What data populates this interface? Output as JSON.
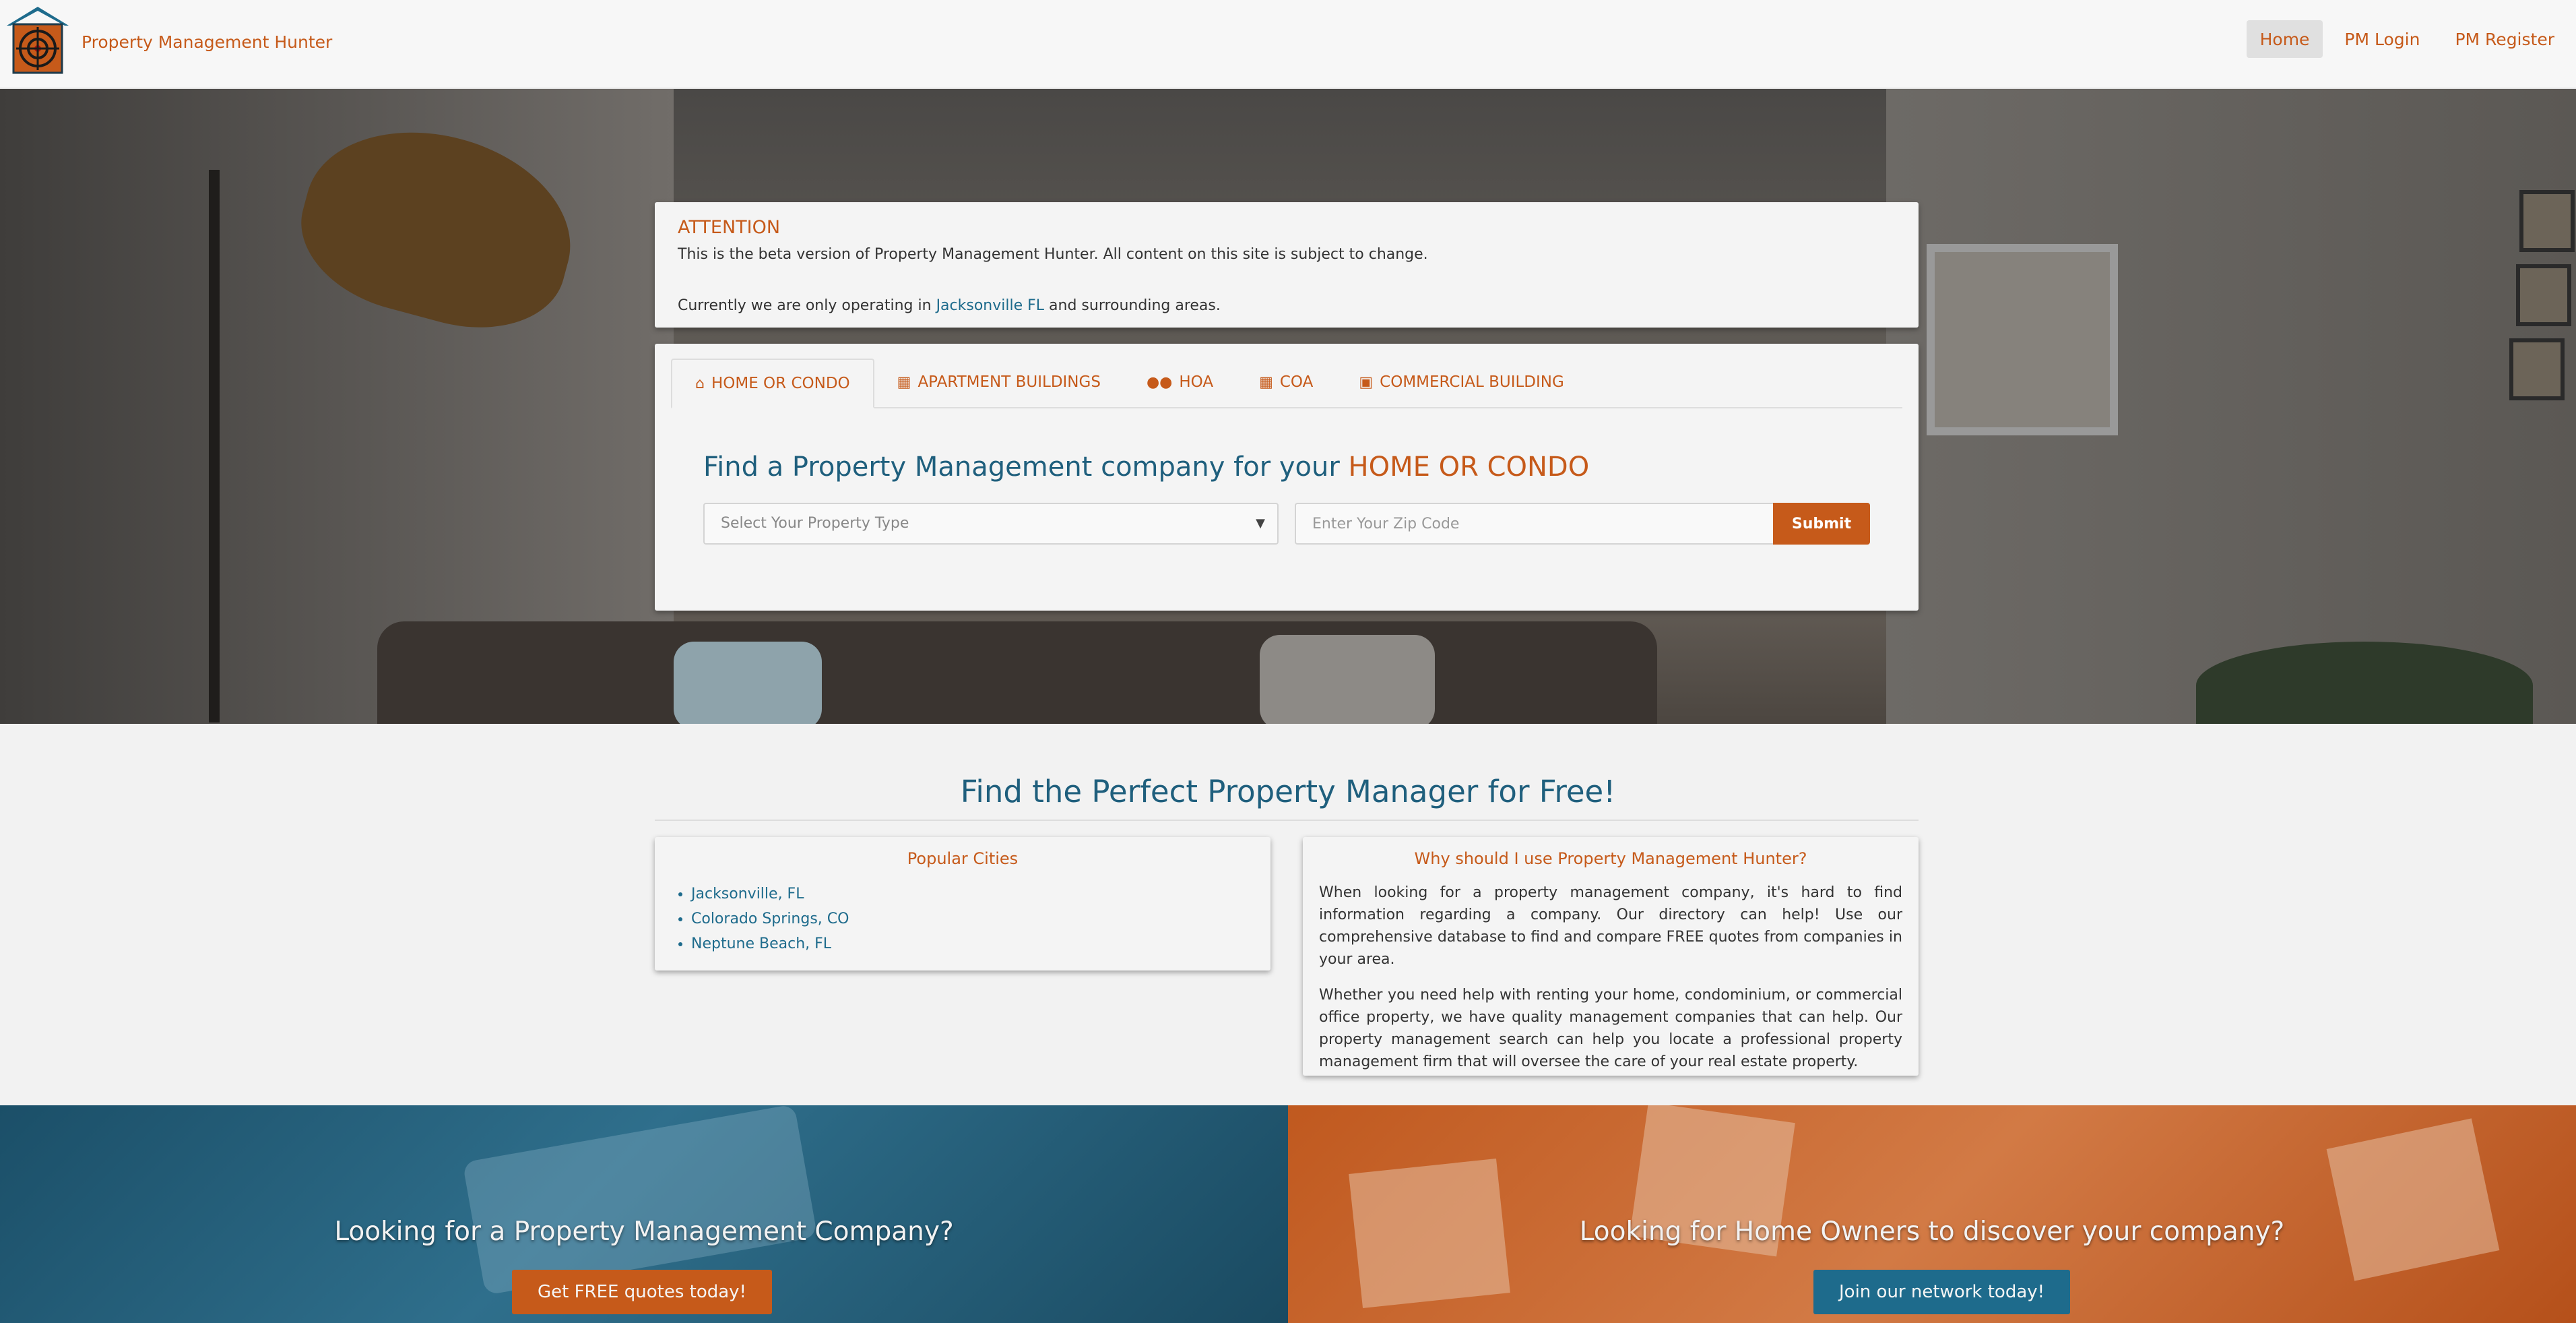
{
  "navbar": {
    "brand": "Property Management Hunter",
    "links": [
      {
        "label": "Home",
        "active": true
      },
      {
        "label": "PM Login",
        "active": false
      },
      {
        "label": "PM Register",
        "active": false
      }
    ]
  },
  "attention": {
    "title": "ATTENTION",
    "line1": "This is the beta version of Property Management Hunter. All content on this site is subject to change.",
    "line2_prefix": "Currently we are only operating in ",
    "line2_link": "Jacksonville FL",
    "line2_suffix": " and surrounding areas."
  },
  "search": {
    "tabs": [
      {
        "label": "HOME OR CONDO",
        "icon": "home-icon",
        "active": true
      },
      {
        "label": "APARTMENT BUILDINGS",
        "icon": "building-icon",
        "active": false
      },
      {
        "label": "HOA",
        "icon": "users-icon",
        "active": false
      },
      {
        "label": "COA",
        "icon": "building-icon",
        "active": false
      },
      {
        "label": "COMMERCIAL BUILDING",
        "icon": "briefcase-icon",
        "active": false
      }
    ],
    "heading_prefix": "Find a Property Management company for your ",
    "heading_highlight": "HOME OR CONDO",
    "select_placeholder": "Select Your Property Type",
    "zip_placeholder": "Enter Your Zip Code",
    "submit_label": "Submit"
  },
  "free": {
    "title": "Find the Perfect Property Manager for Free!",
    "cities_title": "Popular Cities",
    "cities": [
      "Jacksonville, FL",
      "Colorado Springs, CO",
      "Neptune Beach, FL"
    ],
    "why_title": "Why should I use Property Management Hunter?",
    "why_p1": "When looking for a property management company, it's hard to find information regarding a company. Our directory can help! Use our comprehensive database to find and compare FREE quotes from companies in your area.",
    "why_p2": "Whether you need help with renting your home, condominium, or commercial office property, we have quality management companies that can help. Our property management search can help you locate a professional property management firm that will oversee the care of your real estate property."
  },
  "banners": {
    "left_text": "Looking for a Property Management Company?",
    "left_button": "Get FREE quotes today!",
    "right_text": "Looking for Home Owners to discover your company?",
    "right_button": "Join our network today!"
  },
  "colors": {
    "brand_orange": "#c65a1a",
    "brand_blue": "#1f5f7d",
    "link_blue": "#1e6b8c"
  }
}
